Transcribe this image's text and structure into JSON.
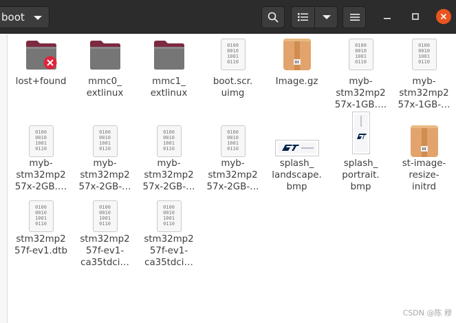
{
  "header": {
    "path_label": "boot",
    "colors": {
      "bar": "#2c2c2c",
      "button": "#3c3c3c",
      "close": "#e95420"
    }
  },
  "icons": {
    "folder": "folder-icon",
    "binary": "binary-file-icon",
    "archive": "archive-icon",
    "image": "image-file-icon",
    "broken": "broken-link-emblem-icon"
  },
  "binary_glyph": [
    "0100",
    "0010",
    "1001",
    "0110"
  ],
  "files": [
    {
      "name": "lost+found",
      "kind": "folder-broken"
    },
    {
      "name": "mmc0_\nextlinux",
      "kind": "folder"
    },
    {
      "name": "mmc1_\nextlinux",
      "kind": "folder"
    },
    {
      "name": "boot.scr.\nuimg",
      "kind": "binary"
    },
    {
      "name": "Image.gz",
      "kind": "archive"
    },
    {
      "name": "myb-\nstm32mp2\n57x-1GB.…",
      "kind": "binary"
    },
    {
      "name": "myb-\nstm32mp2\n57x-1GB-…",
      "kind": "binary"
    },
    {
      "name": "myb-\nstm32mp2\n57x-2GB.…",
      "kind": "binary"
    },
    {
      "name": "myb-\nstm32mp2\n57x-2GB-…",
      "kind": "binary"
    },
    {
      "name": "myb-\nstm32mp2\n57x-2GB-…",
      "kind": "binary"
    },
    {
      "name": "myb-\nstm32mp2\n57x-2GB-…",
      "kind": "binary"
    },
    {
      "name": "splash_\nlandscape.\nbmp",
      "kind": "image-landscape"
    },
    {
      "name": "splash_\nportrait.\nbmp",
      "kind": "image-portrait"
    },
    {
      "name": "st-image-\nresize-\ninitrd",
      "kind": "archive"
    },
    {
      "name": "stm32mp2\n57f-ev1.dtb",
      "kind": "binary"
    },
    {
      "name": "stm32mp2\n57f-ev1-\nca35tdci…",
      "kind": "binary"
    },
    {
      "name": "stm32mp2\n57f-ev1-\nca35tdci…",
      "kind": "binary"
    }
  ],
  "watermark": "CSDN @陈 穆"
}
